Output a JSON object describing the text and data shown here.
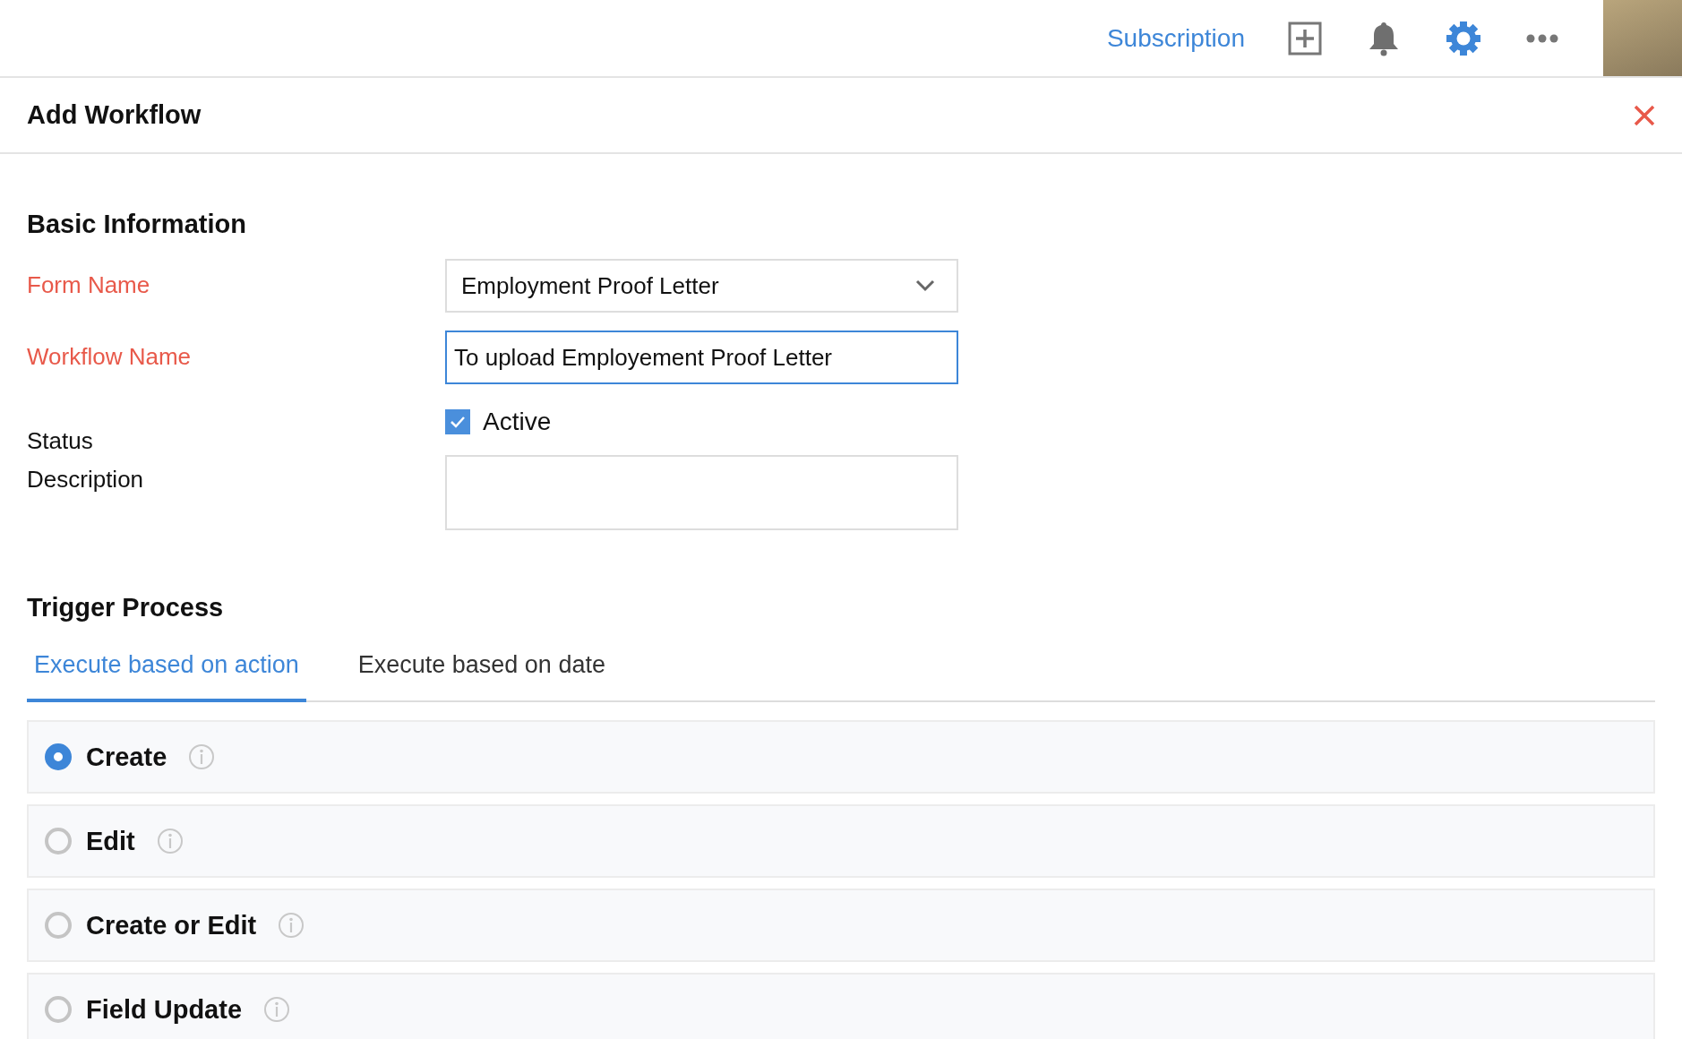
{
  "topbar": {
    "subscription_link": "Subscription"
  },
  "panel": {
    "title": "Add Workflow"
  },
  "basic_information": {
    "heading": "Basic Information",
    "fields": [
      {
        "kind": "select",
        "label": "Form Name",
        "required": true,
        "value": "Employment Proof Letter"
      },
      {
        "kind": "text",
        "label": "Workflow Name",
        "required": true,
        "focused": true,
        "value": "To upload Employement Proof Letter"
      },
      {
        "kind": "checkbox",
        "label": "Status",
        "required": false,
        "option": "Active",
        "checked": true
      },
      {
        "kind": "textarea",
        "label": "Description",
        "required": false
      }
    ]
  },
  "trigger_process": {
    "heading": "Trigger Process",
    "tabs": [
      {
        "label": "Execute based on action",
        "selected": true
      },
      {
        "label": "Execute based on date",
        "selected": false
      }
    ],
    "options": [
      {
        "label": "Create",
        "selected": true
      },
      {
        "label": "Edit",
        "selected": false
      },
      {
        "label": "Create or Edit",
        "selected": false
      },
      {
        "label": "Field Update",
        "selected": false
      }
    ]
  }
}
